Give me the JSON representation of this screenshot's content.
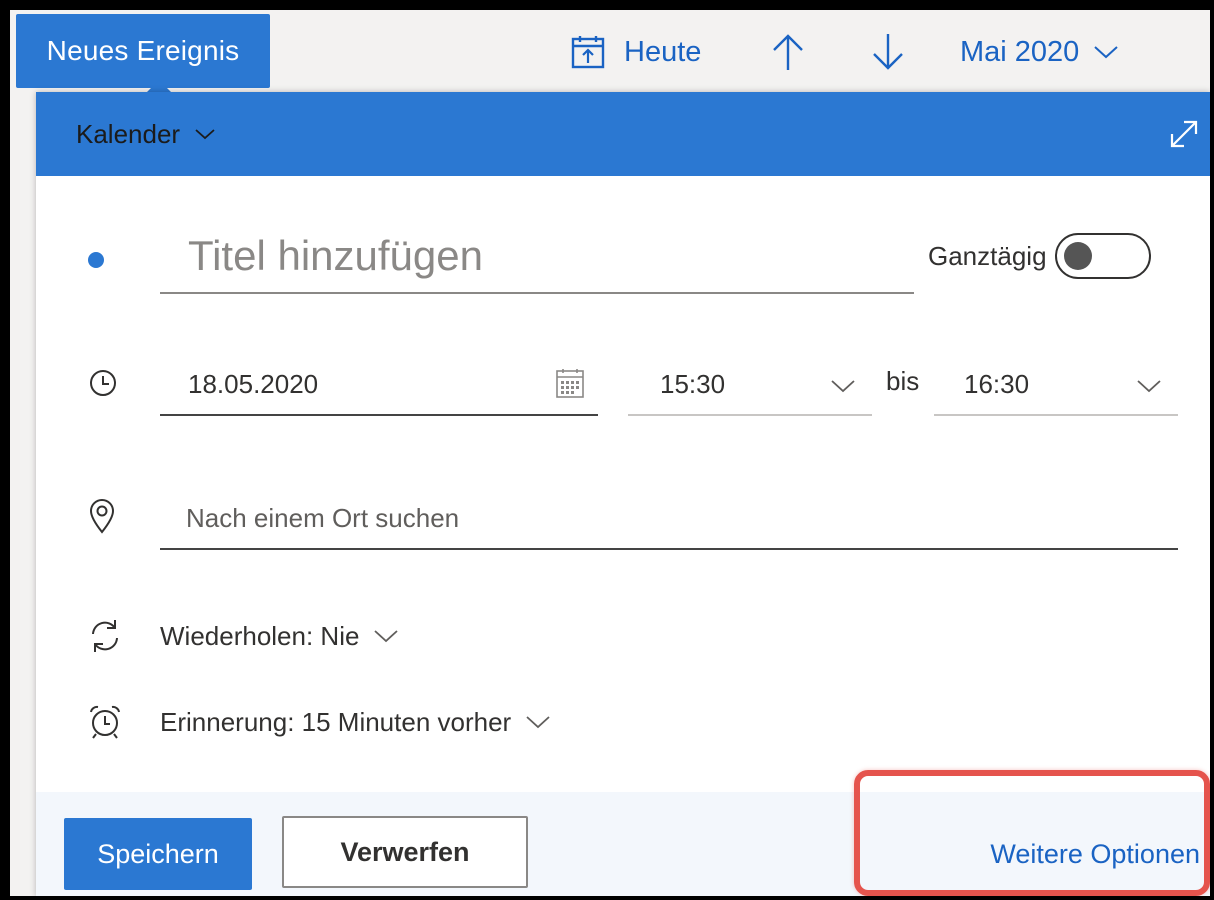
{
  "toolbar": {
    "new_event_label": "Neues Ereignis",
    "today_label": "Heute",
    "month_label": "Mai 2020"
  },
  "dialog": {
    "calendar_label": "Kalender",
    "title_placeholder": "Titel hinzufügen",
    "all_day_label": "Ganztägig",
    "all_day_on": false,
    "date_value": "18.05.2020",
    "start_time": "15:30",
    "to_label": "bis",
    "end_time": "16:30",
    "location_placeholder": "Nach einem Ort suchen",
    "repeat_label": "Wiederholen: Nie",
    "reminder_label": "Erinnerung: 15 Minuten vorher"
  },
  "footer": {
    "save_label": "Speichern",
    "discard_label": "Verwerfen",
    "more_options_label": "Weitere Optionen"
  },
  "colors": {
    "accent": "#2b78d2",
    "link": "#1a63c3",
    "highlight": "#e5544d"
  }
}
